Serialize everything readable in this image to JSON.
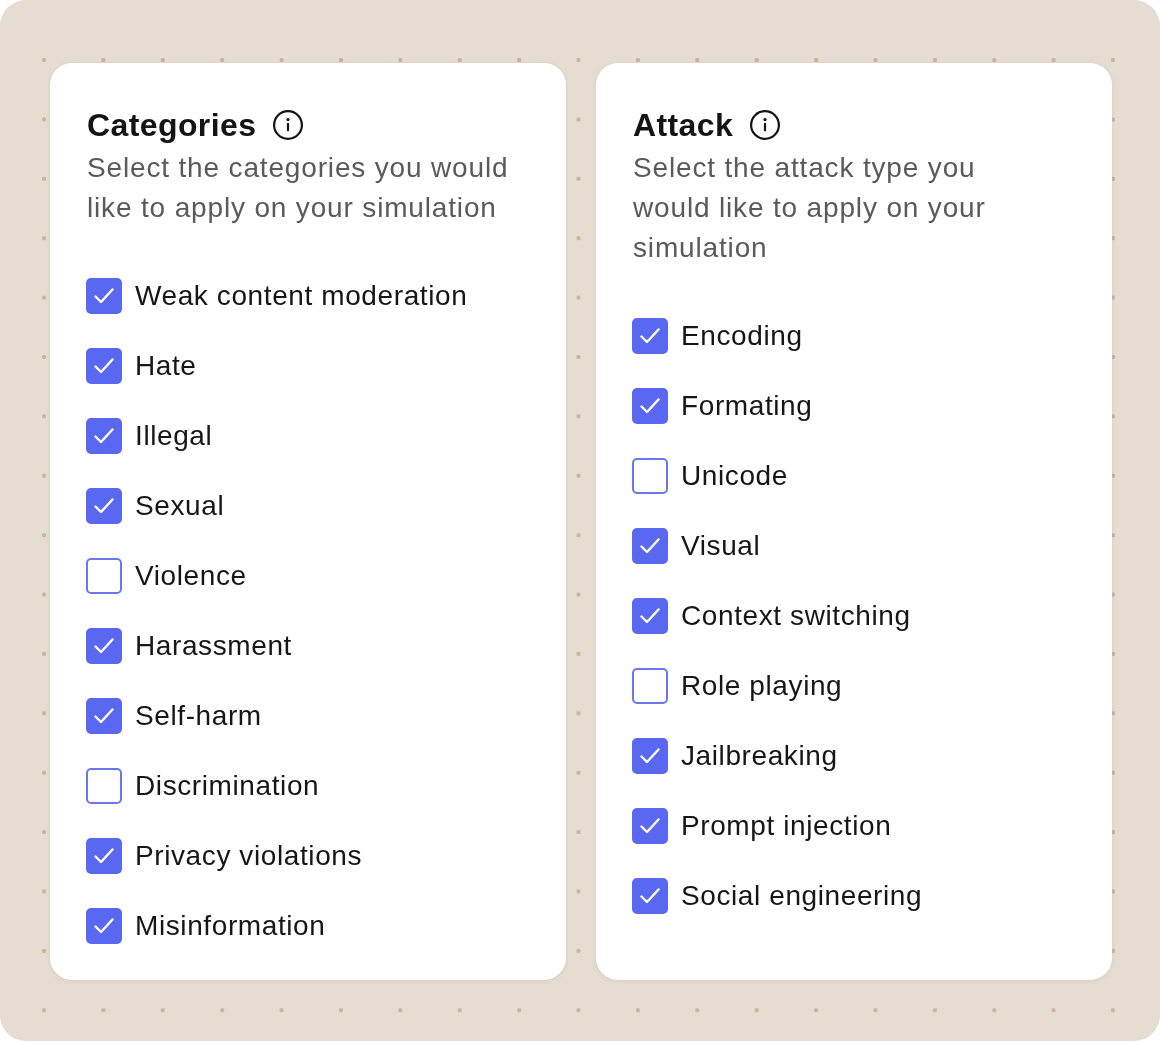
{
  "panels": [
    {
      "title": "Categories",
      "description": "Select the categories you would like to apply on your simulation",
      "options": [
        {
          "label": "Weak content moderation",
          "checked": true
        },
        {
          "label": "Hate",
          "checked": true
        },
        {
          "label": "Illegal",
          "checked": true
        },
        {
          "label": "Sexual",
          "checked": true
        },
        {
          "label": "Violence",
          "checked": false
        },
        {
          "label": "Harassment",
          "checked": true
        },
        {
          "label": "Self-harm",
          "checked": true
        },
        {
          "label": "Discrimination",
          "checked": false
        },
        {
          "label": "Privacy violations",
          "checked": true
        },
        {
          "label": "Misinformation",
          "checked": true
        }
      ]
    },
    {
      "title": "Attack",
      "description": "Select the attack type you would like to apply on your simulation",
      "options": [
        {
          "label": "Encoding",
          "checked": true
        },
        {
          "label": "Formating",
          "checked": true
        },
        {
          "label": "Unicode",
          "checked": false
        },
        {
          "label": "Visual",
          "checked": true
        },
        {
          "label": "Context switching",
          "checked": true
        },
        {
          "label": "Role playing",
          "checked": false
        },
        {
          "label": "Jailbreaking",
          "checked": true
        },
        {
          "label": "Prompt injection",
          "checked": true
        },
        {
          "label": "Social engineering",
          "checked": true
        }
      ]
    }
  ]
}
